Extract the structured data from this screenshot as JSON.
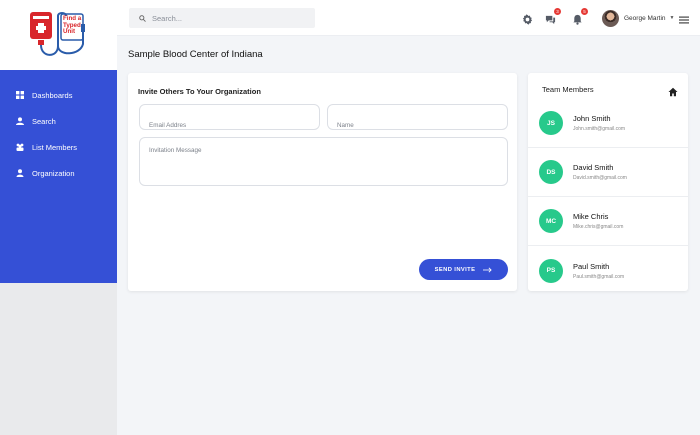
{
  "logo": {
    "line1": "Find a",
    "line2": "Typed",
    "line3": "Unit"
  },
  "nav": {
    "items": [
      {
        "label": "Dashboards",
        "icon": "grid-icon"
      },
      {
        "label": "Search",
        "icon": "user-search-icon"
      },
      {
        "label": "List Members",
        "icon": "users-icon"
      },
      {
        "label": "Organization",
        "icon": "person-icon"
      }
    ]
  },
  "header": {
    "search_placeholder": "Search...",
    "messages_badge": "3",
    "notifications_badge": "5",
    "user_name": "George Martin"
  },
  "page": {
    "title": "Sample Blood Center of Indiana"
  },
  "invite": {
    "title": "Invite Others To Your Organization",
    "email_placeholder": "Email Addres",
    "name_placeholder": "Name",
    "message_placeholder": "Invitation Message",
    "send_label": "SEND INVITE"
  },
  "team": {
    "title": "Team Members",
    "members": [
      {
        "initials": "JS",
        "name": "John Smith",
        "email": "John.smith@gmail.com"
      },
      {
        "initials": "DS",
        "name": "David Smith",
        "email": "David.smith@gmail.com"
      },
      {
        "initials": "MC",
        "name": "Mike Chris",
        "email": "Mike.chris@gmail.com"
      },
      {
        "initials": "PS",
        "name": "Paul Smith",
        "email": "Paul.smith@gmail.com"
      }
    ]
  },
  "colors": {
    "primary": "#3550d6",
    "avatar": "#27c98b",
    "badge": "#e53935",
    "logo_red": "#d8262b"
  }
}
